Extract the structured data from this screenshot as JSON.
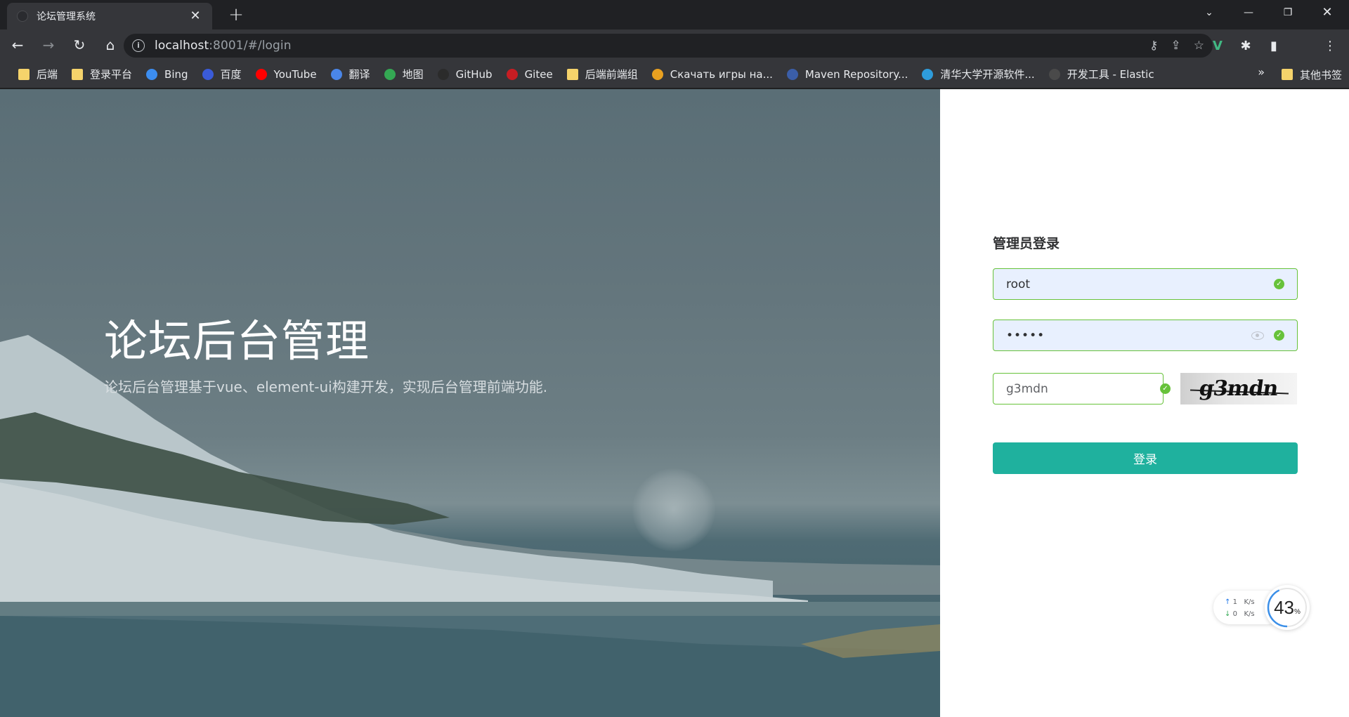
{
  "browser": {
    "tab_title": "论坛管理系统",
    "url_host": "localhost",
    "url_rest": ":8001/#/login"
  },
  "bookmarks": [
    {
      "label": "后端",
      "icon": "folder-icon",
      "color": "#f5d36b"
    },
    {
      "label": "登录平台",
      "icon": "folder-icon",
      "color": "#f5d36b"
    },
    {
      "label": "Bing",
      "icon": "search-icon",
      "color": "#3c8df0"
    },
    {
      "label": "百度",
      "icon": "baidu-icon",
      "color": "#3a5bd9"
    },
    {
      "label": "YouTube",
      "icon": "youtube-icon",
      "color": "#ff0000"
    },
    {
      "label": "翻译",
      "icon": "translate-icon",
      "color": "#4a86e8"
    },
    {
      "label": "地图",
      "icon": "maps-pin-icon",
      "color": "#34a853"
    },
    {
      "label": "GitHub",
      "icon": "github-icon",
      "color": "#2b2b2b"
    },
    {
      "label": "Gitee",
      "icon": "gitee-icon",
      "color": "#c71d23"
    },
    {
      "label": "后端前端组",
      "icon": "folder-icon",
      "color": "#f5d36b"
    },
    {
      "label": "Скачать игры на...",
      "icon": "game-icon",
      "color": "#e8a020"
    },
    {
      "label": "Maven Repository...",
      "icon": "maven-icon",
      "color": "#3b5ea8"
    },
    {
      "label": "清华大学开源软件...",
      "icon": "tuna-icon",
      "color": "#2e9cdb"
    },
    {
      "label": "开发工具 - Elastic",
      "icon": "elastic-icon",
      "color": "#4a4a4a"
    }
  ],
  "bookmarks_more": "»",
  "bookmarks_other": "其他书签",
  "hero": {
    "title": "论坛后台管理",
    "subtitle": "论坛后台管理基于vue、element-ui构建开发，实现后台管理前端功能."
  },
  "login": {
    "title": "管理员登录",
    "username": "root",
    "password": "•••••",
    "captcha_input": "g3mdn",
    "captcha_image_text": "g3mdn",
    "submit_label": "登录",
    "accent_color": "#1fb19e",
    "valid_color": "#67c23a"
  },
  "net_widget": {
    "up": "1",
    "down": "0",
    "unit": "K/s",
    "percent": "43",
    "percent_unit": "%"
  }
}
